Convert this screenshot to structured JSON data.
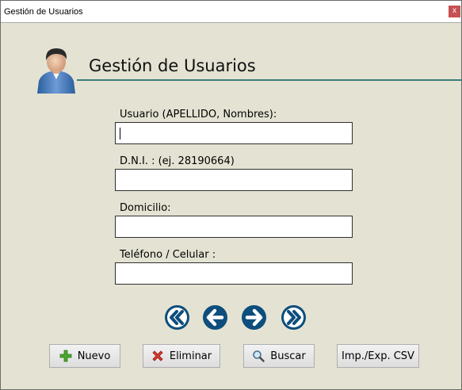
{
  "window": {
    "title": "Gestión de Usuarios",
    "close_glyph": "x"
  },
  "header": {
    "title": "Gestión de Usuarios",
    "icon": "user-avatar-icon",
    "accent_color": "#3d7d7a"
  },
  "form": {
    "usuario": {
      "label": "Usuario (APELLIDO, Nombres):",
      "value": "",
      "placeholder": ""
    },
    "dni": {
      "label": "D.N.I. :  (ej.  28190664)",
      "value": "",
      "placeholder": ""
    },
    "domicilio": {
      "label": "Domicilio:",
      "value": "",
      "placeholder": ""
    },
    "telefono": {
      "label": "Teléfono / Celular :",
      "value": "",
      "placeholder": ""
    }
  },
  "navigation": {
    "buttons": [
      {
        "name": "first-record",
        "icon": "double-chevron-left-icon"
      },
      {
        "name": "previous-record",
        "icon": "arrow-left-icon"
      },
      {
        "name": "next-record",
        "icon": "arrow-right-icon"
      },
      {
        "name": "last-record",
        "icon": "double-chevron-right-icon"
      }
    ],
    "color": "#0d4e7c"
  },
  "actions": {
    "nuevo": {
      "label": "Nuevo",
      "icon": "plus-icon"
    },
    "eliminar": {
      "label": "Eliminar",
      "icon": "delete-x-icon"
    },
    "buscar": {
      "label": "Buscar",
      "icon": "magnifier-icon"
    },
    "csv": {
      "label": "Imp./Exp. CSV"
    }
  }
}
